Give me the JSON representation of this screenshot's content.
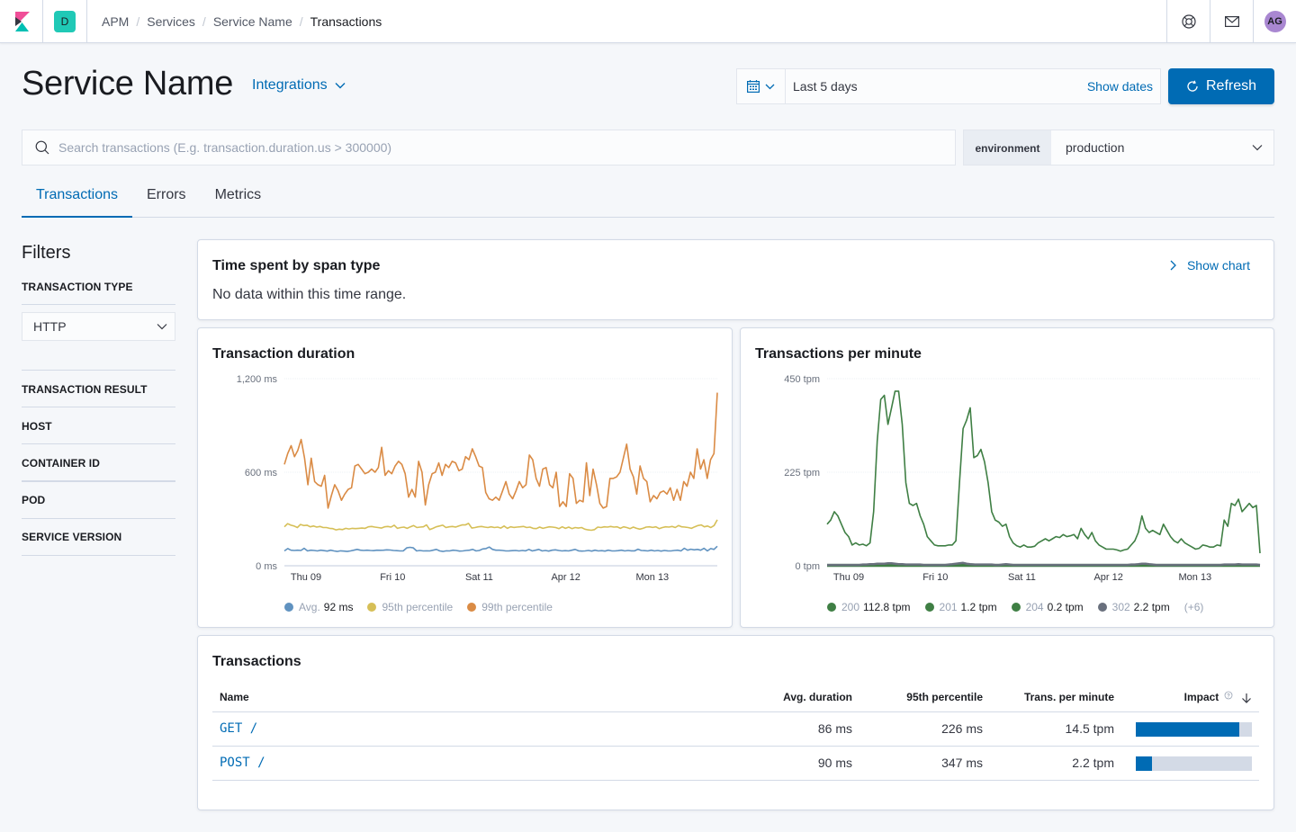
{
  "header": {
    "space_initial": "D",
    "breadcrumbs": [
      "APM",
      "Services",
      "Service Name",
      "Transactions"
    ],
    "avatar_initials": "AG",
    "icons": [
      "kibana-logo-icon",
      "help-icon",
      "mail-icon"
    ]
  },
  "page": {
    "title": "Service Name",
    "integrations_label": "Integrations"
  },
  "datepicker": {
    "range": "Last 5 days",
    "show_dates_label": "Show dates",
    "refresh_label": "Refresh"
  },
  "search": {
    "placeholder": "Search transactions (E.g. transaction.duration.us > 300000)",
    "value": ""
  },
  "environment": {
    "label": "environment",
    "selected": "production"
  },
  "tabs": [
    {
      "label": "Transactions",
      "active": true
    },
    {
      "label": "Errors",
      "active": false
    },
    {
      "label": "Metrics",
      "active": false
    }
  ],
  "filters": {
    "title": "Filters",
    "transaction_type_label": "TRANSACTION TYPE",
    "transaction_type_value": "HTTP",
    "groups": [
      "TRANSACTION RESULT",
      "HOST",
      "CONTAINER ID",
      "POD",
      "SERVICE VERSION"
    ]
  },
  "span_panel": {
    "title": "Time spent by span type",
    "show_chart_label": "Show chart",
    "message": "No data within this time range."
  },
  "transactions_table": {
    "title": "Transactions",
    "columns": [
      "Name",
      "Avg. duration",
      "95th percentile",
      "Trans. per minute",
      "Impact"
    ],
    "rows": [
      {
        "name": "GET /",
        "avg_duration": "86 ms",
        "p95": "226 ms",
        "tpm": "14.5 tpm",
        "impact": 0.89
      },
      {
        "name": "POST /",
        "avg_duration": "90 ms",
        "p95": "347 ms",
        "tpm": "2.2 tpm",
        "impact": 0.14
      }
    ]
  },
  "chart_data": [
    {
      "type": "line",
      "title": "Transaction duration",
      "xlabel": "",
      "ylabel": "",
      "ylim": [
        0,
        1200
      ],
      "yticks": [
        "0 ms",
        "600 ms",
        "1,200 ms"
      ],
      "ytick_values": [
        0,
        600,
        1200
      ],
      "xticks": [
        "Thu 09",
        "Fri 10",
        "Sat 11",
        "Apr 12",
        "Mon 13"
      ],
      "xtick_positions": [
        0.05,
        0.25,
        0.45,
        0.65,
        0.85
      ],
      "grid": true,
      "legend": "bottom",
      "series": [
        {
          "name": "Avg.",
          "legend_value": "92 ms",
          "color": "#6092c0",
          "values": [
            95,
            110,
            100,
            98,
            100,
            98,
            112,
            95,
            100,
            98,
            95,
            100,
            97,
            94,
            100,
            95,
            92,
            96,
            94,
            92,
            95,
            100,
            105,
            100,
            98,
            100,
            98,
            97,
            100,
            99,
            100,
            102,
            101,
            98,
            97,
            95,
            96,
            115,
            118,
            115,
            95,
            98,
            95,
            96,
            95,
            100,
            105,
            95,
            92,
            96,
            95,
            100,
            98,
            94,
            95,
            98,
            100,
            105,
            95,
            98,
            108,
            110,
            120,
            105,
            100,
            100,
            98,
            95,
            96,
            97,
            98,
            95,
            98,
            96,
            105,
            95,
            100,
            105,
            95,
            98,
            94,
            100,
            102,
            98,
            95,
            97,
            95,
            100,
            105,
            96,
            94,
            95,
            98,
            94,
            100,
            95,
            97,
            94,
            100,
            96,
            95,
            97,
            100,
            95,
            98,
            96,
            96,
            106,
            98,
            97,
            95,
            100,
            95,
            98,
            94,
            98,
            96,
            95,
            98,
            100,
            95,
            112,
            100,
            106,
            102,
            105,
            100,
            112,
            95,
            110,
            105,
            125
          ]
        },
        {
          "name": "95th percentile",
          "legend_value": "",
          "color": "#d6bf57",
          "values": [
            250,
            270,
            260,
            255,
            245,
            265,
            258,
            260,
            250,
            255,
            248,
            252,
            245,
            245,
            240,
            238,
            230,
            235,
            232,
            240,
            236,
            240,
            238,
            240,
            242,
            240,
            250,
            252,
            248,
            245,
            242,
            250,
            252,
            248,
            260,
            240,
            245,
            248,
            240,
            250,
            258,
            245,
            248,
            250,
            262,
            232,
            240,
            250,
            255,
            260,
            245,
            250,
            252,
            248,
            255,
            262,
            262,
            272,
            242,
            245,
            250,
            252,
            248,
            245,
            250,
            245,
            248,
            242,
            255,
            240,
            250,
            246,
            248,
            250,
            252,
            245,
            248,
            240,
            238,
            248,
            240,
            245,
            250,
            248,
            245,
            238,
            250,
            240,
            248,
            238,
            245,
            242,
            245,
            235,
            230,
            228,
            232,
            248,
            245,
            250,
            248,
            252,
            248,
            250,
            240,
            250,
            245,
            238,
            248,
            240,
            235,
            240,
            248,
            250,
            246,
            250,
            238,
            245,
            250,
            248,
            252,
            245,
            258,
            250,
            248,
            245,
            240,
            250,
            258,
            262,
            250,
            255,
            245,
            258,
            295
          ]
        },
        {
          "name": "99th percentile",
          "legend_value": "",
          "color": "#da8b45",
          "values": [
            650,
            720,
            770,
            700,
            740,
            810,
            690,
            520,
            690,
            540,
            520,
            510,
            580,
            370,
            450,
            520,
            480,
            420,
            460,
            490,
            500,
            640,
            650,
            620,
            590,
            600,
            620,
            600,
            630,
            760,
            580,
            610,
            590,
            640,
            670,
            650,
            590,
            440,
            490,
            440,
            670,
            600,
            390,
            520,
            590,
            600,
            660,
            580,
            650,
            630,
            670,
            660,
            610,
            620,
            700,
            680,
            750,
            700,
            640,
            630,
            470,
            430,
            420,
            440,
            420,
            480,
            540,
            460,
            430,
            480,
            540,
            500,
            520,
            710,
            680,
            560,
            510,
            620,
            630,
            520,
            500,
            600,
            380,
            410,
            380,
            590,
            560,
            400,
            420,
            410,
            660,
            450,
            620,
            520,
            400,
            370,
            380,
            560,
            560,
            570,
            600,
            690,
            780,
            620,
            570,
            460,
            640,
            560,
            540,
            410,
            450,
            430,
            470,
            480,
            460,
            500,
            420,
            490,
            420,
            540,
            510,
            600,
            560,
            750,
            620,
            680,
            560,
            680,
            720,
            1110
          ]
        }
      ]
    },
    {
      "type": "line",
      "title": "Transactions per minute",
      "xlabel": "",
      "ylabel": "",
      "ylim": [
        0,
        450
      ],
      "yticks": [
        "0 tpm",
        "225 tpm",
        "450 tpm"
      ],
      "ytick_values": [
        0,
        225,
        450
      ],
      "xticks": [
        "Thu 09",
        "Fri 10",
        "Sat 11",
        "Apr 12",
        "Mon 13"
      ],
      "xtick_positions": [
        0.05,
        0.25,
        0.45,
        0.65,
        0.85
      ],
      "grid": true,
      "legend": "bottom",
      "legend_more": "(+6)",
      "series": [
        {
          "name": "200",
          "legend_value": "112.8 tpm",
          "color": "#3f7f44",
          "values": [
            100,
            110,
            130,
            120,
            100,
            80,
            70,
            50,
            55,
            50,
            52,
            48,
            55,
            130,
            300,
            400,
            410,
            340,
            380,
            420,
            420,
            340,
            200,
            150,
            145,
            150,
            120,
            100,
            70,
            60,
            50,
            48,
            48,
            48,
            50,
            50,
            60,
            200,
            330,
            350,
            380,
            260,
            265,
            280,
            250,
            200,
            130,
            110,
            105,
            95,
            100,
            70,
            55,
            48,
            45,
            50,
            45,
            45,
            47,
            55,
            60,
            65,
            60,
            65,
            70,
            68,
            75,
            70,
            72,
            75,
            65,
            90,
            75,
            65,
            80,
            60,
            50,
            45,
            40,
            40,
            40,
            38,
            35,
            38,
            40,
            50,
            60,
            80,
            120,
            90,
            80,
            85,
            80,
            75,
            100,
            85,
            70,
            60,
            55,
            65,
            55,
            50,
            45,
            40,
            42,
            50,
            48,
            45,
            45,
            50,
            48,
            110,
            95,
            150,
            145,
            160,
            130,
            140,
            150,
            140,
            145,
            30
          ]
        },
        {
          "name": "201",
          "legend_value": "1.2 tpm",
          "color": "#3f7f44",
          "values": [
            2,
            2,
            2,
            2,
            2,
            2,
            2,
            2,
            2,
            2,
            2,
            2,
            2,
            2,
            3,
            3,
            3,
            3,
            3,
            3,
            3,
            3,
            2,
            2,
            2,
            2,
            2,
            2,
            2,
            2,
            2,
            2,
            2,
            2,
            2,
            2,
            2,
            3,
            4,
            3,
            3,
            3,
            2,
            2,
            2,
            2,
            2,
            2,
            2,
            2,
            2,
            2,
            2,
            2,
            2,
            2,
            2,
            2,
            2,
            2,
            2,
            2,
            2,
            2,
            2,
            2,
            2,
            2,
            2,
            2,
            2,
            2,
            2,
            2,
            2,
            2,
            2,
            2,
            2,
            2,
            2,
            2,
            2,
            2,
            2,
            2,
            2,
            2,
            2,
            2,
            2,
            2,
            2,
            2,
            2,
            2,
            2,
            2,
            2,
            2,
            2,
            2,
            2,
            2,
            2,
            2,
            2,
            2,
            2,
            2,
            2,
            2,
            2,
            2,
            2,
            2,
            2,
            2,
            2,
            2,
            2,
            2
          ]
        },
        {
          "name": "204",
          "legend_value": "0.2 tpm",
          "color": "#3f7f44",
          "values": [
            0,
            0,
            0,
            0,
            0,
            0,
            0,
            0,
            0,
            0,
            0,
            0,
            0,
            0,
            0,
            0,
            0,
            0,
            0,
            0,
            0,
            0,
            0,
            0,
            0,
            0,
            0,
            0,
            0,
            0,
            0,
            0,
            0,
            0,
            0,
            0,
            0,
            0,
            0,
            0,
            0,
            0,
            0,
            0,
            0,
            0,
            0,
            0,
            0,
            0,
            0,
            0,
            0,
            0,
            0,
            0,
            0,
            0,
            0,
            0,
            0,
            0,
            0,
            0,
            0,
            0,
            0,
            0,
            0,
            0,
            0,
            0,
            0,
            0,
            0,
            0,
            0,
            0,
            0,
            0,
            0,
            0,
            0,
            0,
            0,
            0,
            0,
            0,
            0,
            0,
            0,
            0,
            0,
            0,
            0,
            0,
            0,
            0,
            0,
            0,
            0,
            0,
            0,
            0,
            0,
            0,
            0,
            0,
            0,
            0,
            0,
            0,
            0,
            0,
            0,
            0,
            0,
            0,
            0,
            0,
            0,
            0
          ]
        },
        {
          "name": "302",
          "legend_value": "2.2 tpm",
          "color": "#69707d",
          "values": [
            2,
            2,
            2,
            2,
            2,
            2,
            2,
            2,
            2,
            2,
            3,
            3,
            4,
            4,
            5,
            5,
            5,
            6,
            6,
            5,
            4,
            4,
            3,
            3,
            3,
            3,
            3,
            2,
            2,
            2,
            2,
            2,
            2,
            2,
            3,
            4,
            5,
            6,
            7,
            5,
            4,
            3,
            3,
            3,
            3,
            3,
            3,
            2,
            2,
            3,
            4,
            3,
            2,
            2,
            2,
            2,
            2,
            2,
            2,
            2,
            2,
            2,
            2,
            2,
            2,
            2,
            2,
            2,
            2,
            2,
            2,
            2,
            2,
            2,
            2,
            2,
            2,
            2,
            2,
            2,
            2,
            2,
            2,
            2,
            2,
            3,
            3,
            4,
            5,
            5,
            4,
            3,
            2,
            2,
            2,
            2,
            2,
            2,
            2,
            2,
            2,
            2,
            2,
            2,
            2,
            2,
            2,
            2,
            2,
            2,
            2,
            3,
            3,
            3,
            3,
            4,
            3,
            3,
            3,
            3,
            3,
            2
          ]
        }
      ]
    }
  ]
}
